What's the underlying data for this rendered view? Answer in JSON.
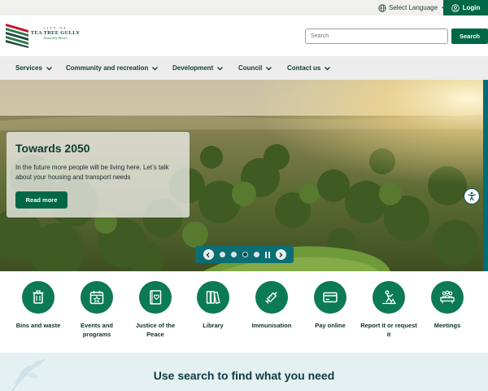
{
  "topbar": {
    "language_label": "Select Language",
    "login_label": "Login"
  },
  "logo": {
    "small": "CITY OF",
    "name": "TEA TREE GULLY",
    "tagline": "Naturally Better"
  },
  "search": {
    "placeholder": "Search",
    "button_label": "Search"
  },
  "nav": {
    "items": [
      {
        "label": "Services"
      },
      {
        "label": "Community and recreation"
      },
      {
        "label": "Development"
      },
      {
        "label": "Council"
      },
      {
        "label": "Contact us"
      }
    ]
  },
  "hero": {
    "title": "Towards 2050",
    "text": "In the future more people will be living here. Let’s talk about your housing and transport needs",
    "button_label": "Read more",
    "active_slide": 3,
    "slide_count": 4
  },
  "quick_links": [
    {
      "label": "Bins and waste",
      "icon": "bin-icon"
    },
    {
      "label": "Events and programs",
      "icon": "calendar-star-icon"
    },
    {
      "label": "Justice of the Peace",
      "icon": "book-heart-icon"
    },
    {
      "label": "Library",
      "icon": "books-icon"
    },
    {
      "label": "Immunisation",
      "icon": "syringe-icon"
    },
    {
      "label": "Pay online",
      "icon": "credit-card-icon"
    },
    {
      "label": "Report it or request it",
      "icon": "worker-icon"
    },
    {
      "label": "Meetings",
      "icon": "meeting-icon"
    }
  ],
  "banner": {
    "title": "Use search to find what you need"
  },
  "colors": {
    "brand_green": "#006747",
    "teal": "#0b6e74",
    "icon_green": "#0b7a55"
  }
}
